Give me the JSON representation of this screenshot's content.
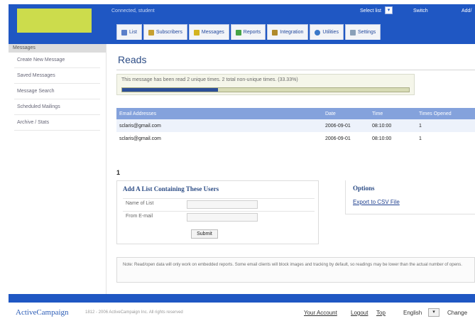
{
  "header": {
    "welcome": "Connected, student",
    "select_list": "Select list",
    "select_arrow": "▾",
    "switch_label": "Switch",
    "add_label": "Add/"
  },
  "tabs": [
    {
      "label": "List",
      "icon": "list-icon",
      "color": "#5b7fc9"
    },
    {
      "label": "Subscribers",
      "icon": "subscribers-icon",
      "color": "#c6a030"
    },
    {
      "label": "Messages",
      "icon": "messages-icon",
      "color": "#d3b320"
    },
    {
      "label": "Reports",
      "icon": "reports-icon",
      "color": "#46a346"
    },
    {
      "label": "Integration",
      "icon": "integration-icon",
      "color": "#b08a2a"
    },
    {
      "label": "Utilities",
      "icon": "utilities-icon",
      "color": "#3a78c8"
    },
    {
      "label": "Settings",
      "icon": "settings-icon",
      "color": "#8aa0b8"
    }
  ],
  "sidebar": {
    "heading": "Messages",
    "items": [
      {
        "label": "Create New Message"
      },
      {
        "label": "Saved Messages"
      },
      {
        "label": "Message Search"
      },
      {
        "label": "Scheduled Mailings"
      },
      {
        "label": "Archive / Stats"
      }
    ]
  },
  "main": {
    "title": "Reads",
    "summary": "This message has been read 2 unique times. 2 total non-unique times. (33.33%)",
    "progress_fraction": 0.3333,
    "table": {
      "headers": [
        "Email Addresses",
        "Date",
        "Time",
        "Times Opened"
      ],
      "rows": [
        [
          "sclaris@gmail.com",
          "2006-09-01",
          "08:10:00",
          "1"
        ],
        [
          "sclaris@gmail.com",
          "2006-09-01",
          "08:10:00",
          "1"
        ]
      ]
    },
    "marker": "1",
    "add_list": {
      "heading": "Add A List Containing These Users",
      "name_label": "Name of List",
      "from_label": "From E-mail",
      "submit": "Submit"
    },
    "options": {
      "heading": "Options",
      "export_link": "Export to CSV File"
    },
    "note": "Note: Read/open data will only work on embedded reports. Some email clients will block images and tracking by default, so readings may be lower than the actual number of opens."
  },
  "footer": {
    "logo": "ActiveCampaign",
    "copyright": "1812 - 2006 ActiveCampaign Inc. All rights reserved",
    "links": [
      "Your Account",
      "Logout",
      "Top"
    ],
    "language": "English",
    "language_arrow": "▾",
    "change": "Change",
    "brand_color": "#1f57c3",
    "logo_color": "#ccdc4c"
  }
}
